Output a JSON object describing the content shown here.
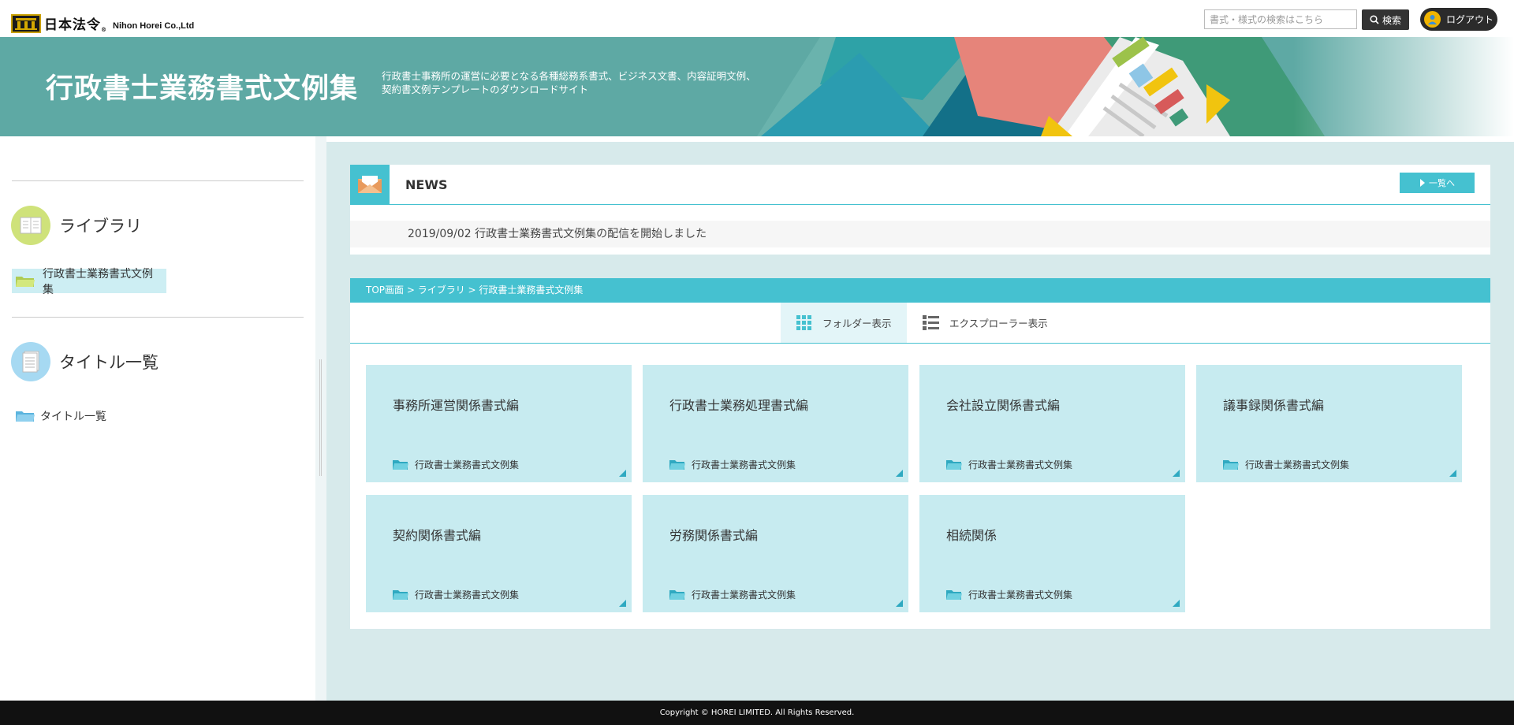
{
  "header": {
    "logo_jp": "日本法令",
    "logo_reg": "®",
    "logo_en": "Nihon Horei Co.,Ltd",
    "search_placeholder": "書式・様式の検索はこちら",
    "search_button": "検索",
    "logout_button": "ログアウト"
  },
  "banner": {
    "title": "行政書士業務書式文例集",
    "description_line1": "行政書士事務所の運営に必要となる各種総務系書式、ビジネス文書、内容証明文例、",
    "description_line2": "契約書文例テンプレートのダウンロードサイト"
  },
  "sidebar": {
    "library_label": "ライブラリ",
    "library_item": "行政書士業務書式文例集",
    "titles_label": "タイトル一覧",
    "titles_item": "タイトル一覧"
  },
  "news": {
    "heading": "NEWS",
    "more_button": "一覧へ",
    "items": [
      {
        "text": "2019/09/02 行政書士業務書式文例集の配信を開始しました"
      }
    ]
  },
  "breadcrumb": "TOP画面 > ライブラリ > 行政書士業務書式文例集",
  "view_tabs": {
    "folder": "フォルダー表示",
    "explorer": "エクスプローラー表示"
  },
  "cards": [
    {
      "title": "事務所運営関係書式編",
      "parent": "行政書士業務書式文例集"
    },
    {
      "title": "行政書士業務処理書式編",
      "parent": "行政書士業務書式文例集"
    },
    {
      "title": "会社設立関係書式編",
      "parent": "行政書士業務書式文例集"
    },
    {
      "title": "議事録関係書式編",
      "parent": "行政書士業務書式文例集"
    },
    {
      "title": "契約関係書式編",
      "parent": "行政書士業務書式文例集"
    },
    {
      "title": "労務関係書式編",
      "parent": "行政書士業務書式文例集"
    },
    {
      "title": "相続関係",
      "parent": "行政書士業務書式文例集"
    }
  ],
  "footer": "Copyright © HOREI LIMITED. All Rights Reserved.",
  "colors": {
    "accent": "#45c1d0",
    "card_bg": "#c7ebf0",
    "main_bg": "#d7eaeb",
    "banner_bg": "#5ea9a4"
  }
}
